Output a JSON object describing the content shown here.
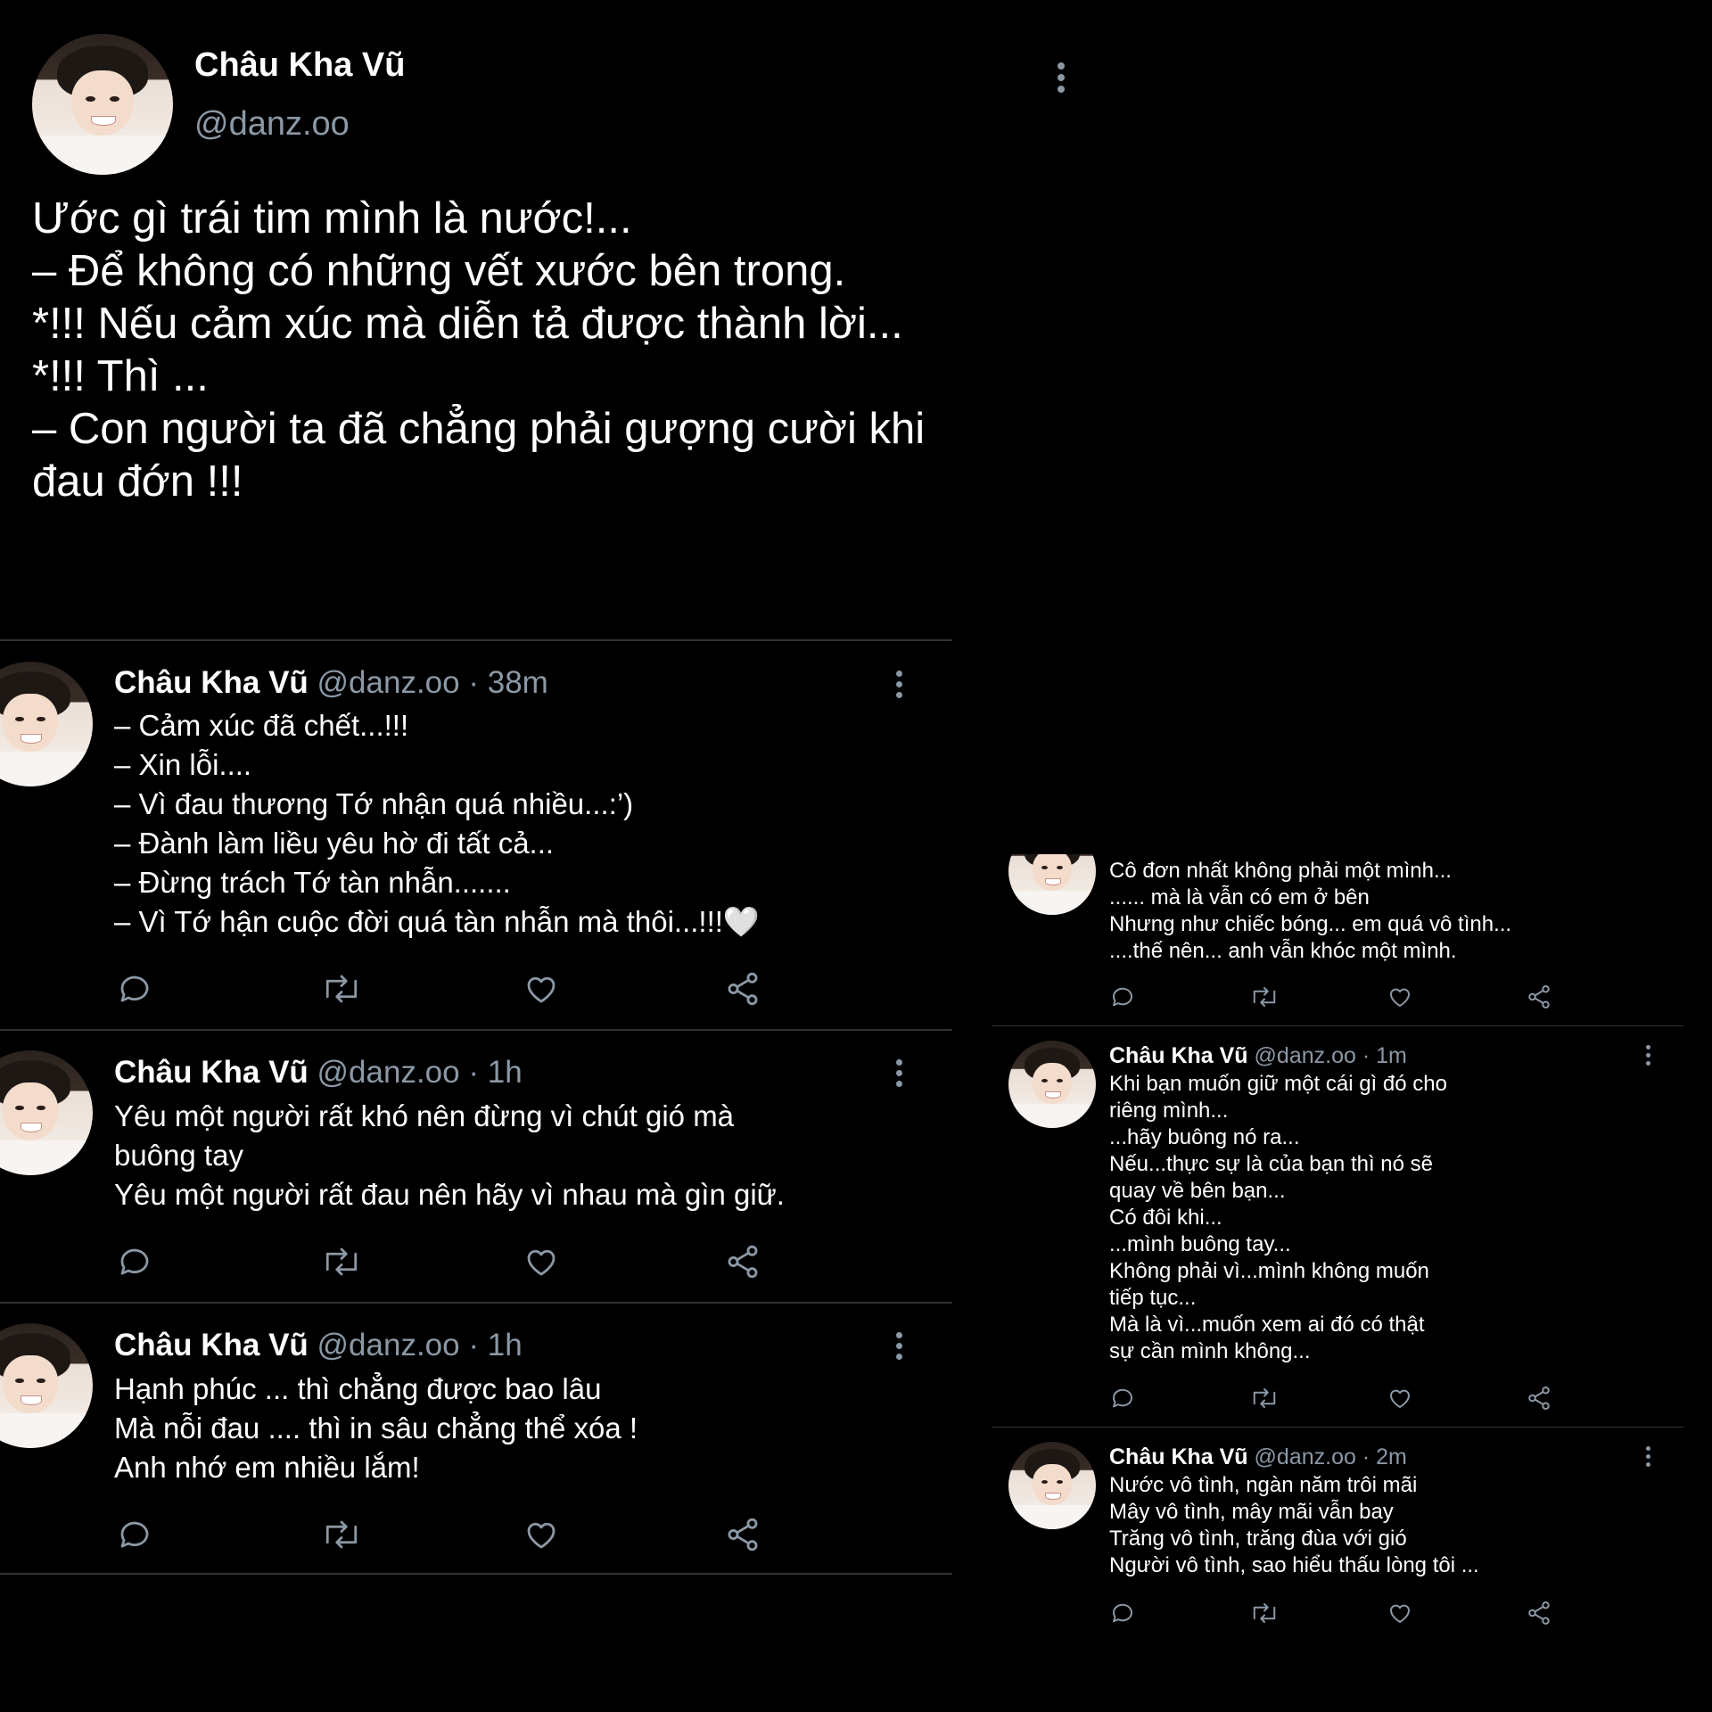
{
  "top_post": {
    "name": "Châu Kha Vũ",
    "handle": "@danz.oo",
    "text": "Ước gì trái tim mình là nước!...\n– Để không có những vết xước bên trong.\n*!!! Nếu cảm xúc mà diễn tả được thành lời...\n*!!! Thì ...\n– Con người ta đã chẳng phải gượng cười khi\nđau đớn !!!"
  },
  "left_tweets": [
    {
      "name": "Châu Kha Vũ",
      "handle": "@danz.oo",
      "time": "· 38m",
      "text": "– Cảm xúc đã chết...!!!\n– Xin lỗi....\n– Vì đau thương Tớ nhận quá nhiều...:’)\n– Đành làm liều yêu hờ đi tất cả...\n– Đừng trách Tớ tàn nhẫn.......\n– Vì Tớ hận cuộc đời quá tàn nhẫn mà thôi...!!!🤍"
    },
    {
      "name": "Châu Kha Vũ",
      "handle": "@danz.oo",
      "time": "· 1h",
      "text": "Yêu một người rất khó nên đừng vì chút gió mà\nbuông tay\nYêu một người rất đau nên hãy vì nhau mà gìn giữ."
    },
    {
      "name": "Châu Kha Vũ",
      "handle": "@danz.oo",
      "time": "· 1h",
      "text": "Hạnh phúc ... thì chẳng được bao lâu\nMà nỗi đau .... thì in sâu chẳng thể xóa !\nAnh nhớ em nhiều lắm!"
    }
  ],
  "right_tweets": [
    {
      "name": "",
      "handle": "",
      "time": "",
      "text": "Cô đơn nhất không phải một mình...\n...... mà là vẫn có em ở bên\nNhưng như chiếc bóng... em quá vô tình...\n....thế nên... anh vẫn khóc một mình."
    },
    {
      "name": "Châu Kha Vũ",
      "handle": "@danz.oo",
      "time": "· 1m",
      "text": "Khi bạn muốn giữ một cái gì đó cho\nriêng mình...\n...hãy buông nó ra...\nNếu...thực sự là của bạn thì nó sẽ\nquay về bên bạn...\nCó đôi khi...\n...mình buông tay...\nKhông phải vì...mình không muốn\ntiếp tục...\nMà là vì...muốn xem ai đó có thật\nsự cần mình không..."
    },
    {
      "name": "Châu Kha Vũ",
      "handle": "@danz.oo",
      "time": "· 2m",
      "text": "Nước vô tình, ngàn năm trôi mãi\nMây vô tình, mây mãi vẫn bay\nTrăng vô tình, trăng đùa với gió\nNgười vô tình, sao hiểu thấu lòng tôi ..."
    }
  ],
  "icons": [
    "reply-icon",
    "retweet-icon",
    "like-icon",
    "share-icon",
    "more-icon"
  ],
  "colors": {
    "background": "#000000",
    "text": "#ffffff",
    "secondary": "#8b98a5",
    "divider": "#2f3336"
  }
}
